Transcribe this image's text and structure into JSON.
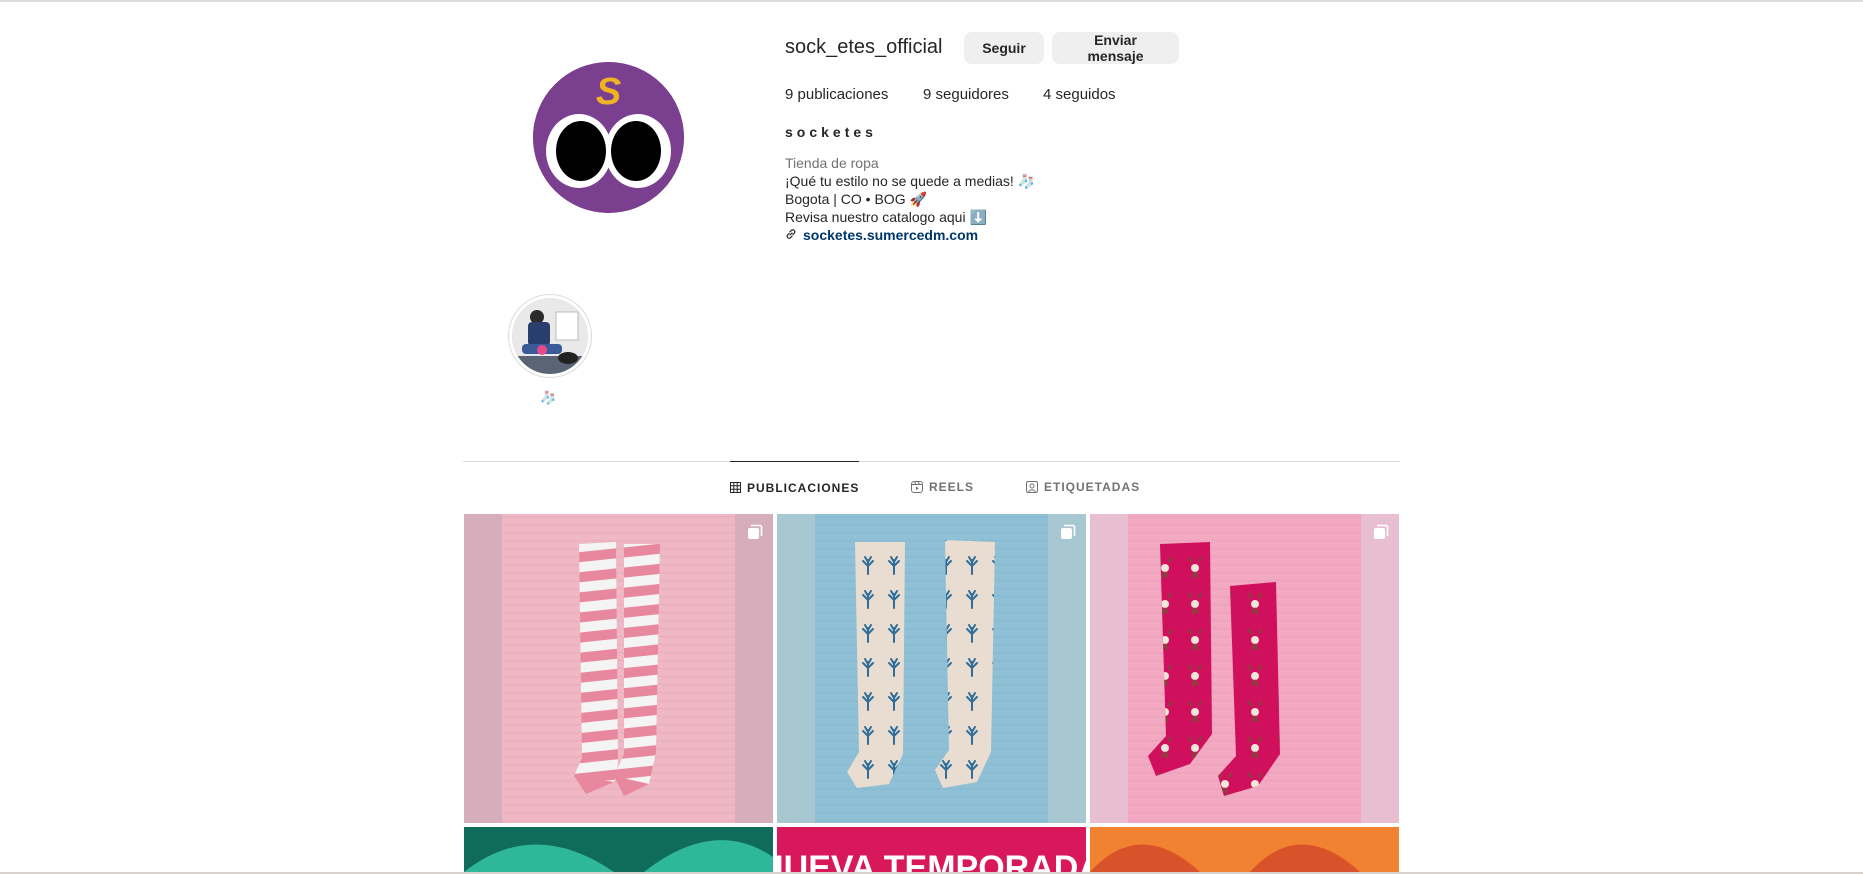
{
  "profile": {
    "username": "sock_etes_official",
    "follow_label": "Seguir",
    "message_label": "Enviar mensaje",
    "stats": {
      "posts": "9 publicaciones",
      "followers": "9 seguidores",
      "following": "4 seguidos"
    },
    "full_name": "socketes",
    "bio": {
      "category": "Tienda de ropa",
      "line1": "¡Qué tu estilo no se quede a medias! 🧦",
      "line2": "Bogota | CO • BOG 🚀",
      "line3": "Revisa nuestro catalogo aqui ⬇️",
      "link": "socketes.sumercedm.com"
    },
    "avatar_letter": "S"
  },
  "highlights": [
    {
      "label": "🧦"
    }
  ],
  "tabs": [
    {
      "label": "PUBLICACIONES",
      "icon": "grid-icon",
      "active": true
    },
    {
      "label": "REELS",
      "icon": "reels-icon",
      "active": false
    },
    {
      "label": "ETIQUETADAS",
      "icon": "tagged-icon",
      "active": false
    }
  ],
  "posts": [
    {
      "icon": "carousel-icon"
    },
    {
      "icon": "carousel-icon"
    },
    {
      "icon": "carousel-icon"
    }
  ],
  "teaser_text": "¡NUEVA TEMPORADA!",
  "colors": {
    "avatar_bg": "#7b3f8f",
    "avatar_letter": "#f0b323",
    "button_bg": "#efefef",
    "link": "#00376b",
    "post1_bg": "#d6adbb",
    "post2_bg": "#a8c8d1",
    "post3_bg": "#e8bfd0",
    "teaser1": "#0f6b5a",
    "teaser2": "#d9185c",
    "teaser3": "#f08232"
  }
}
